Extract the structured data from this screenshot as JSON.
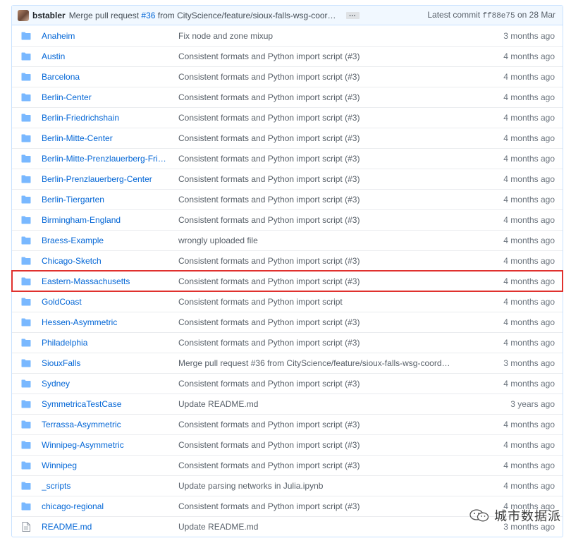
{
  "commit_bar": {
    "author": "bstabler",
    "message_prefix": "Merge pull request ",
    "pr_link": "#36",
    "message_suffix": " from CityScience/feature/sioux-falls-wsg-coord…",
    "ellipsis": "…",
    "latest_label": "Latest commit ",
    "sha": "ff88e75",
    "date": " on 28 Mar"
  },
  "rows": [
    {
      "type": "dir",
      "name": "Anaheim",
      "message": "Fix node and zone mixup",
      "age": "3 months ago"
    },
    {
      "type": "dir",
      "name": "Austin",
      "message": "Consistent formats and Python import script (#3)",
      "age": "4 months ago"
    },
    {
      "type": "dir",
      "name": "Barcelona",
      "message": "Consistent formats and Python import script (#3)",
      "age": "4 months ago"
    },
    {
      "type": "dir",
      "name": "Berlin-Center",
      "message": "Consistent formats and Python import script (#3)",
      "age": "4 months ago"
    },
    {
      "type": "dir",
      "name": "Berlin-Friedrichshain",
      "message": "Consistent formats and Python import script (#3)",
      "age": "4 months ago"
    },
    {
      "type": "dir",
      "name": "Berlin-Mitte-Center",
      "message": "Consistent formats and Python import script (#3)",
      "age": "4 months ago"
    },
    {
      "type": "dir",
      "name": "Berlin-Mitte-Prenzlauerberg-Frie…",
      "message": "Consistent formats and Python import script (#3)",
      "age": "4 months ago"
    },
    {
      "type": "dir",
      "name": "Berlin-Prenzlauerberg-Center",
      "message": "Consistent formats and Python import script (#3)",
      "age": "4 months ago"
    },
    {
      "type": "dir",
      "name": "Berlin-Tiergarten",
      "message": "Consistent formats and Python import script (#3)",
      "age": "4 months ago"
    },
    {
      "type": "dir",
      "name": "Birmingham-England",
      "message": "Consistent formats and Python import script (#3)",
      "age": "4 months ago"
    },
    {
      "type": "dir",
      "name": "Braess-Example",
      "message": "wrongly uploaded file",
      "age": "4 months ago"
    },
    {
      "type": "dir",
      "name": "Chicago-Sketch",
      "message": "Consistent formats and Python import script (#3)",
      "age": "4 months ago"
    },
    {
      "type": "dir",
      "name": "Eastern-Massachusetts",
      "message": "Consistent formats and Python import script (#3)",
      "age": "4 months ago",
      "highlight": true
    },
    {
      "type": "dir",
      "name": "GoldCoast",
      "message": "Consistent formats and Python import script",
      "age": "4 months ago"
    },
    {
      "type": "dir",
      "name": "Hessen-Asymmetric",
      "message": "Consistent formats and Python import script (#3)",
      "age": "4 months ago"
    },
    {
      "type": "dir",
      "name": "Philadelphia",
      "message": "Consistent formats and Python import script (#3)",
      "age": "4 months ago"
    },
    {
      "type": "dir",
      "name": "SiouxFalls",
      "message": "Merge pull request #36 from CityScience/feature/sioux-falls-wsg-coord…",
      "age": "3 months ago"
    },
    {
      "type": "dir",
      "name": "Sydney",
      "message": "Consistent formats and Python import script (#3)",
      "age": "4 months ago"
    },
    {
      "type": "dir",
      "name": "SymmetricaTestCase",
      "message": "Update README.md",
      "age": "3 years ago"
    },
    {
      "type": "dir",
      "name": "Terrassa-Asymmetric",
      "message": "Consistent formats and Python import script (#3)",
      "age": "4 months ago"
    },
    {
      "type": "dir",
      "name": "Winnipeg-Asymmetric",
      "message": "Consistent formats and Python import script (#3)",
      "age": "4 months ago"
    },
    {
      "type": "dir",
      "name": "Winnipeg",
      "message": "Consistent formats and Python import script (#3)",
      "age": "4 months ago"
    },
    {
      "type": "dir",
      "name": "_scripts",
      "message": "Update parsing networks in Julia.ipynb",
      "age": "4 months ago"
    },
    {
      "type": "dir",
      "name": "chicago-regional",
      "message": "Consistent formats and Python import script (#3)",
      "age": "4 months ago"
    },
    {
      "type": "file",
      "name": "README.md",
      "message": "Update README.md",
      "age": "3 months ago"
    }
  ],
  "icons": {
    "dir": "folder-icon",
    "file": "file-icon"
  },
  "colors": {
    "link": "#0366d6",
    "folder": "#79b8ff",
    "highlight": "#e0312e",
    "header_bg": "#f1f8ff"
  },
  "watermark": {
    "text": "城市数据派"
  }
}
